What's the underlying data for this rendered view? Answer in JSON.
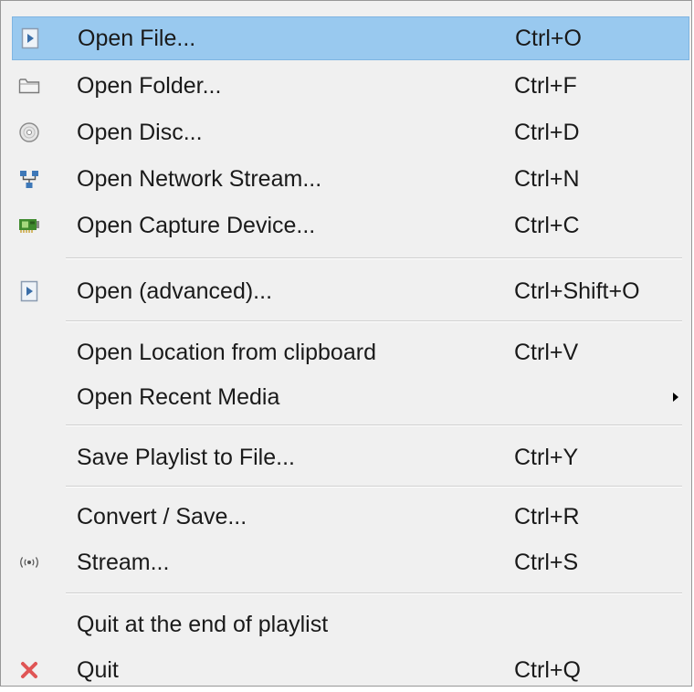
{
  "menu": {
    "items": [
      {
        "label": "Open File...",
        "shortcut": "Ctrl+O",
        "icon": "open-file-icon"
      },
      {
        "label": "Open Folder...",
        "shortcut": "Ctrl+F",
        "icon": "folder-icon"
      },
      {
        "label": "Open Disc...",
        "shortcut": "Ctrl+D",
        "icon": "disc-icon"
      },
      {
        "label": "Open Network Stream...",
        "shortcut": "Ctrl+N",
        "icon": "network-icon"
      },
      {
        "label": "Open Capture Device...",
        "shortcut": "Ctrl+C",
        "icon": "capture-card-icon"
      },
      {
        "label": "Open (advanced)...",
        "shortcut": "Ctrl+Shift+O",
        "icon": "open-advanced-icon"
      },
      {
        "label": "Open Location from clipboard",
        "shortcut": "Ctrl+V"
      },
      {
        "label": "Open Recent Media",
        "shortcut": "",
        "submenu": true
      },
      {
        "label": "Save Playlist to File...",
        "shortcut": "Ctrl+Y"
      },
      {
        "label": "Convert / Save...",
        "shortcut": "Ctrl+R"
      },
      {
        "label": "Stream...",
        "shortcut": "Ctrl+S",
        "icon": "stream-icon"
      },
      {
        "label": "Quit at the end of playlist",
        "shortcut": ""
      },
      {
        "label": "Quit",
        "shortcut": "Ctrl+Q",
        "icon": "quit-icon"
      }
    ]
  },
  "colors": {
    "menu_background": "#f0f0f0",
    "highlight": "#99c9ef",
    "quit_icon": "#e05555"
  }
}
